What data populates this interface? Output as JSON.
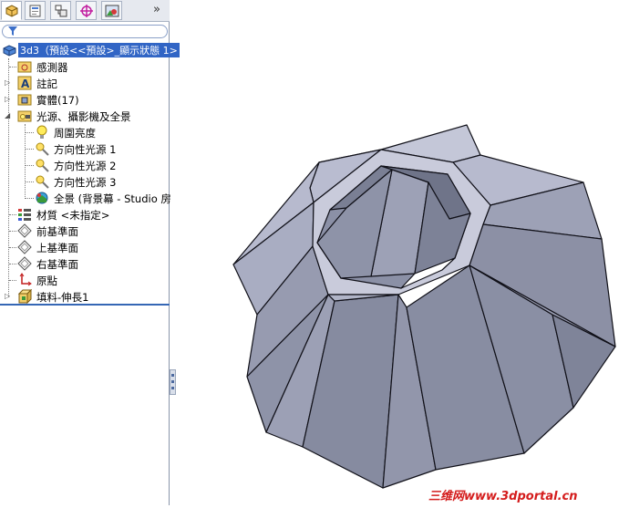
{
  "feature_manager": {
    "overflow_label": "»",
    "tabs": [
      "feature-manager-tab",
      "property-manager-tab",
      "configuration-manager-tab",
      "dimxpert-tab",
      "display-manager-tab"
    ],
    "root": "3d3（預設<<預設>_顯示狀態 1>",
    "items": [
      {
        "label": "感測器",
        "icon": "sensor-folder-icon"
      },
      {
        "label": "註記",
        "icon": "annotation-icon"
      },
      {
        "label": "實體(17)",
        "icon": "solid-bodies-icon"
      },
      {
        "label": "光源、攝影機及全景",
        "icon": "lights-cameras-icon"
      },
      {
        "label": "周圍亮度",
        "icon": "ambient-light-icon"
      },
      {
        "label": "方向性光源 1",
        "icon": "directional-light-icon"
      },
      {
        "label": "方向性光源 2",
        "icon": "directional-light-icon"
      },
      {
        "label": "方向性光源 3",
        "icon": "directional-light-icon"
      },
      {
        "label": "全景 (背景幕 - Studio 房",
        "icon": "scene-icon"
      },
      {
        "label": "材質 <未指定>",
        "icon": "material-icon"
      },
      {
        "label": "前基準面",
        "icon": "plane-icon"
      },
      {
        "label": "上基準面",
        "icon": "plane-icon"
      },
      {
        "label": "右基準面",
        "icon": "plane-icon"
      },
      {
        "label": "原點",
        "icon": "origin-icon"
      },
      {
        "label": "填料-伸長1",
        "icon": "extrude-icon"
      }
    ]
  },
  "watermark": "三维网www.3dportal.cn",
  "colors": {
    "selection": "#3165c5",
    "model_face": "#8d93a8",
    "model_light": "#b9bdd0",
    "watermark": "#d41c1c"
  }
}
